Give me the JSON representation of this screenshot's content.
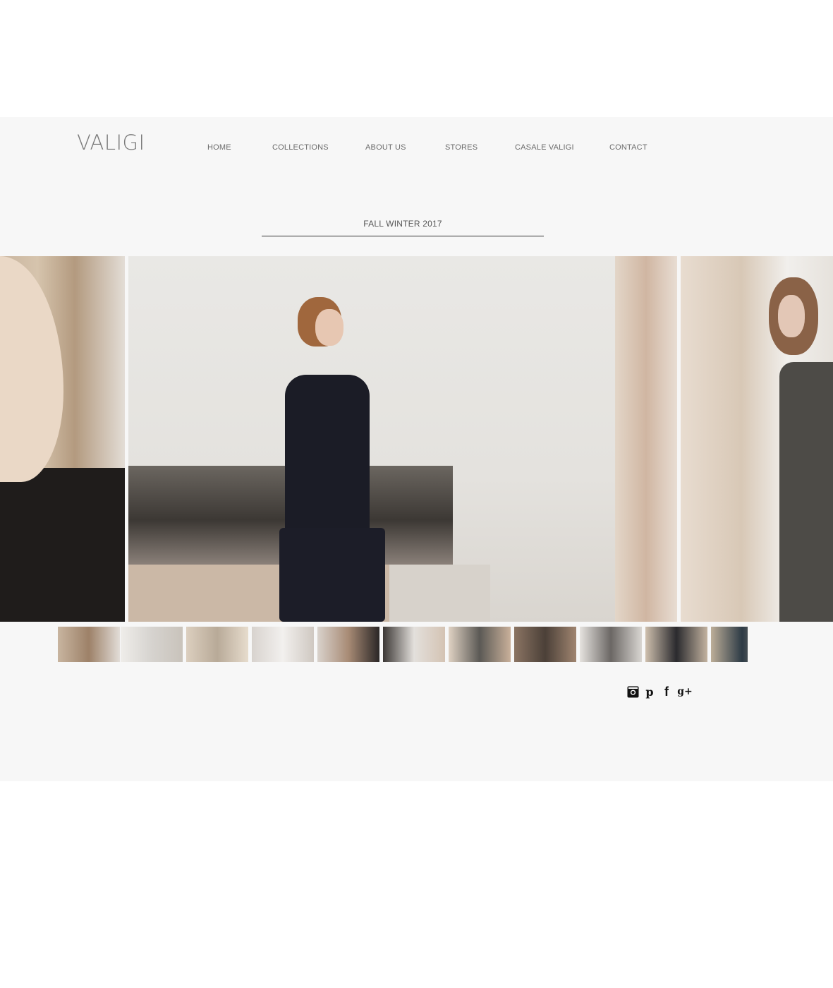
{
  "header": {
    "logo": "VALIGI"
  },
  "nav": {
    "items": [
      {
        "label": "HOME"
      },
      {
        "label": "COLLECTIONS"
      },
      {
        "label": "ABOUT US"
      },
      {
        "label": "STORES"
      },
      {
        "label": "CASALE VALIGI"
      },
      {
        "label": "CONTACT"
      }
    ]
  },
  "section": {
    "title": "FALL WINTER 2017"
  },
  "gallery": {
    "thumbnail_count": 11
  },
  "social": {
    "icons": [
      "instagram-icon",
      "pinterest-icon",
      "facebook-icon",
      "google-plus-icon"
    ],
    "glyphs": {
      "pinterest": "p",
      "facebook": "f",
      "google_plus": "g+"
    }
  },
  "colors": {
    "band": "#f7f7f7",
    "logo": "#7a7a7a",
    "nav_text": "#6b6b6b",
    "rule": "#333333"
  }
}
